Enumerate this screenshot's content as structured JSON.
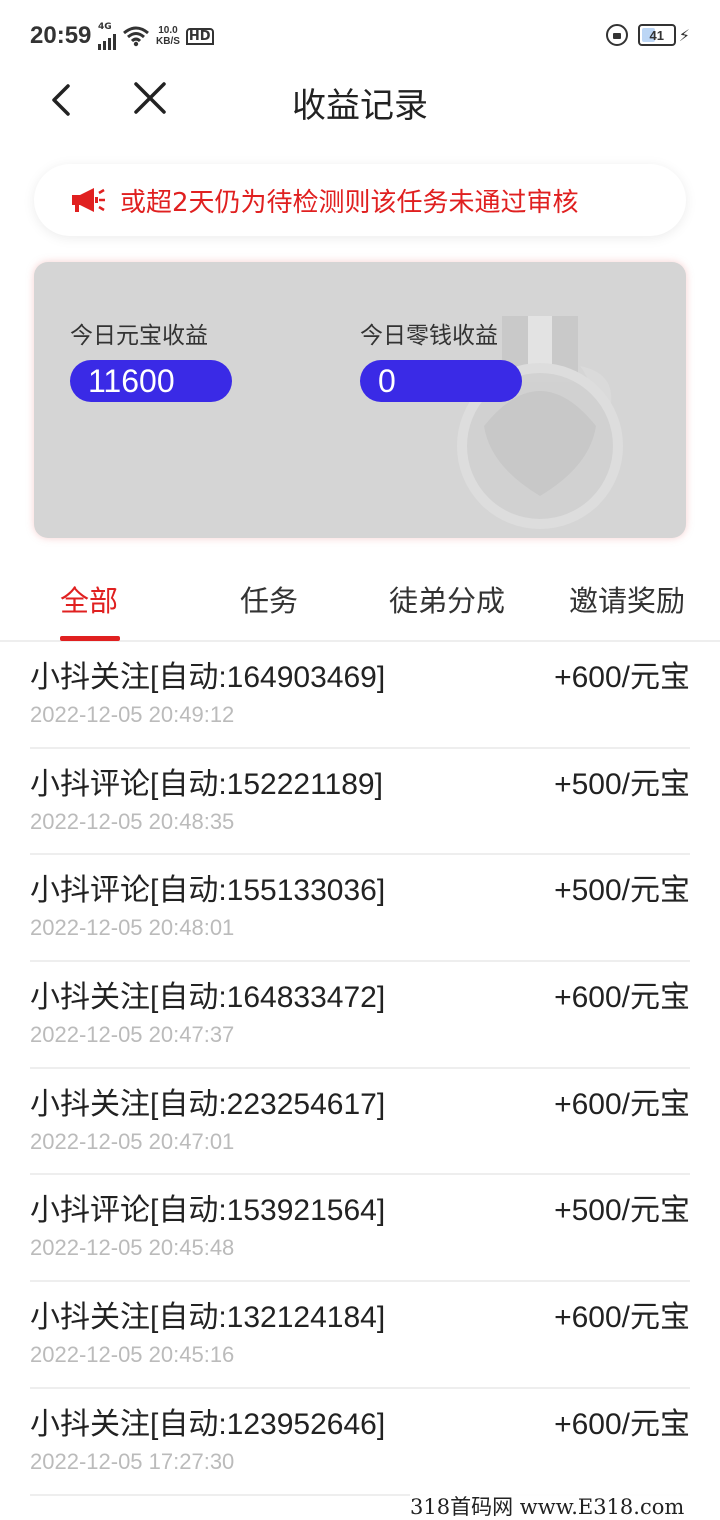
{
  "status_bar": {
    "time": "20:59",
    "network_type": "4G",
    "speed_value": "10.0",
    "speed_unit": "KB/S",
    "hd_label": "HD",
    "battery_level": "41"
  },
  "header": {
    "title": "收益记录"
  },
  "notice": {
    "text": "或超2天仍为待检测则该任务未通过审核",
    "color": "#e02020"
  },
  "earnings": {
    "yuanbao_label": "今日元宝收益",
    "yuanbao_value": "11600",
    "change_label": "今日零钱收益",
    "change_value": "0",
    "pill_color": "#3a2ae6"
  },
  "tabs": [
    {
      "label": "全部",
      "active": true
    },
    {
      "label": "任务",
      "active": false
    },
    {
      "label": "徒弟分成",
      "active": false
    },
    {
      "label": "邀请奖励",
      "active": false
    }
  ],
  "records": [
    {
      "title": "小抖关注[自动:164903469]",
      "time": "2022-12-05 20:49:12",
      "amount": "+600/元宝"
    },
    {
      "title": "小抖评论[自动:152221189]",
      "time": "2022-12-05 20:48:35",
      "amount": "+500/元宝"
    },
    {
      "title": "小抖评论[自动:155133036]",
      "time": "2022-12-05 20:48:01",
      "amount": "+500/元宝"
    },
    {
      "title": "小抖关注[自动:164833472]",
      "time": "2022-12-05 20:47:37",
      "amount": "+600/元宝"
    },
    {
      "title": "小抖关注[自动:223254617]",
      "time": "2022-12-05 20:47:01",
      "amount": "+600/元宝"
    },
    {
      "title": "小抖评论[自动:153921564]",
      "time": "2022-12-05 20:45:48",
      "amount": "+500/元宝"
    },
    {
      "title": "小抖关注[自动:132124184]",
      "time": "2022-12-05 20:45:16",
      "amount": "+600/元宝"
    },
    {
      "title": "小抖关注[自动:123952646]",
      "time": "2022-12-05 17:27:30",
      "amount": "+600/元宝"
    }
  ],
  "watermark": {
    "text": "318首码网 www.E318.com"
  },
  "colors": {
    "accent": "#e02020",
    "muted_text": "#bbbbbb",
    "card_background": "#d5d5d5"
  }
}
